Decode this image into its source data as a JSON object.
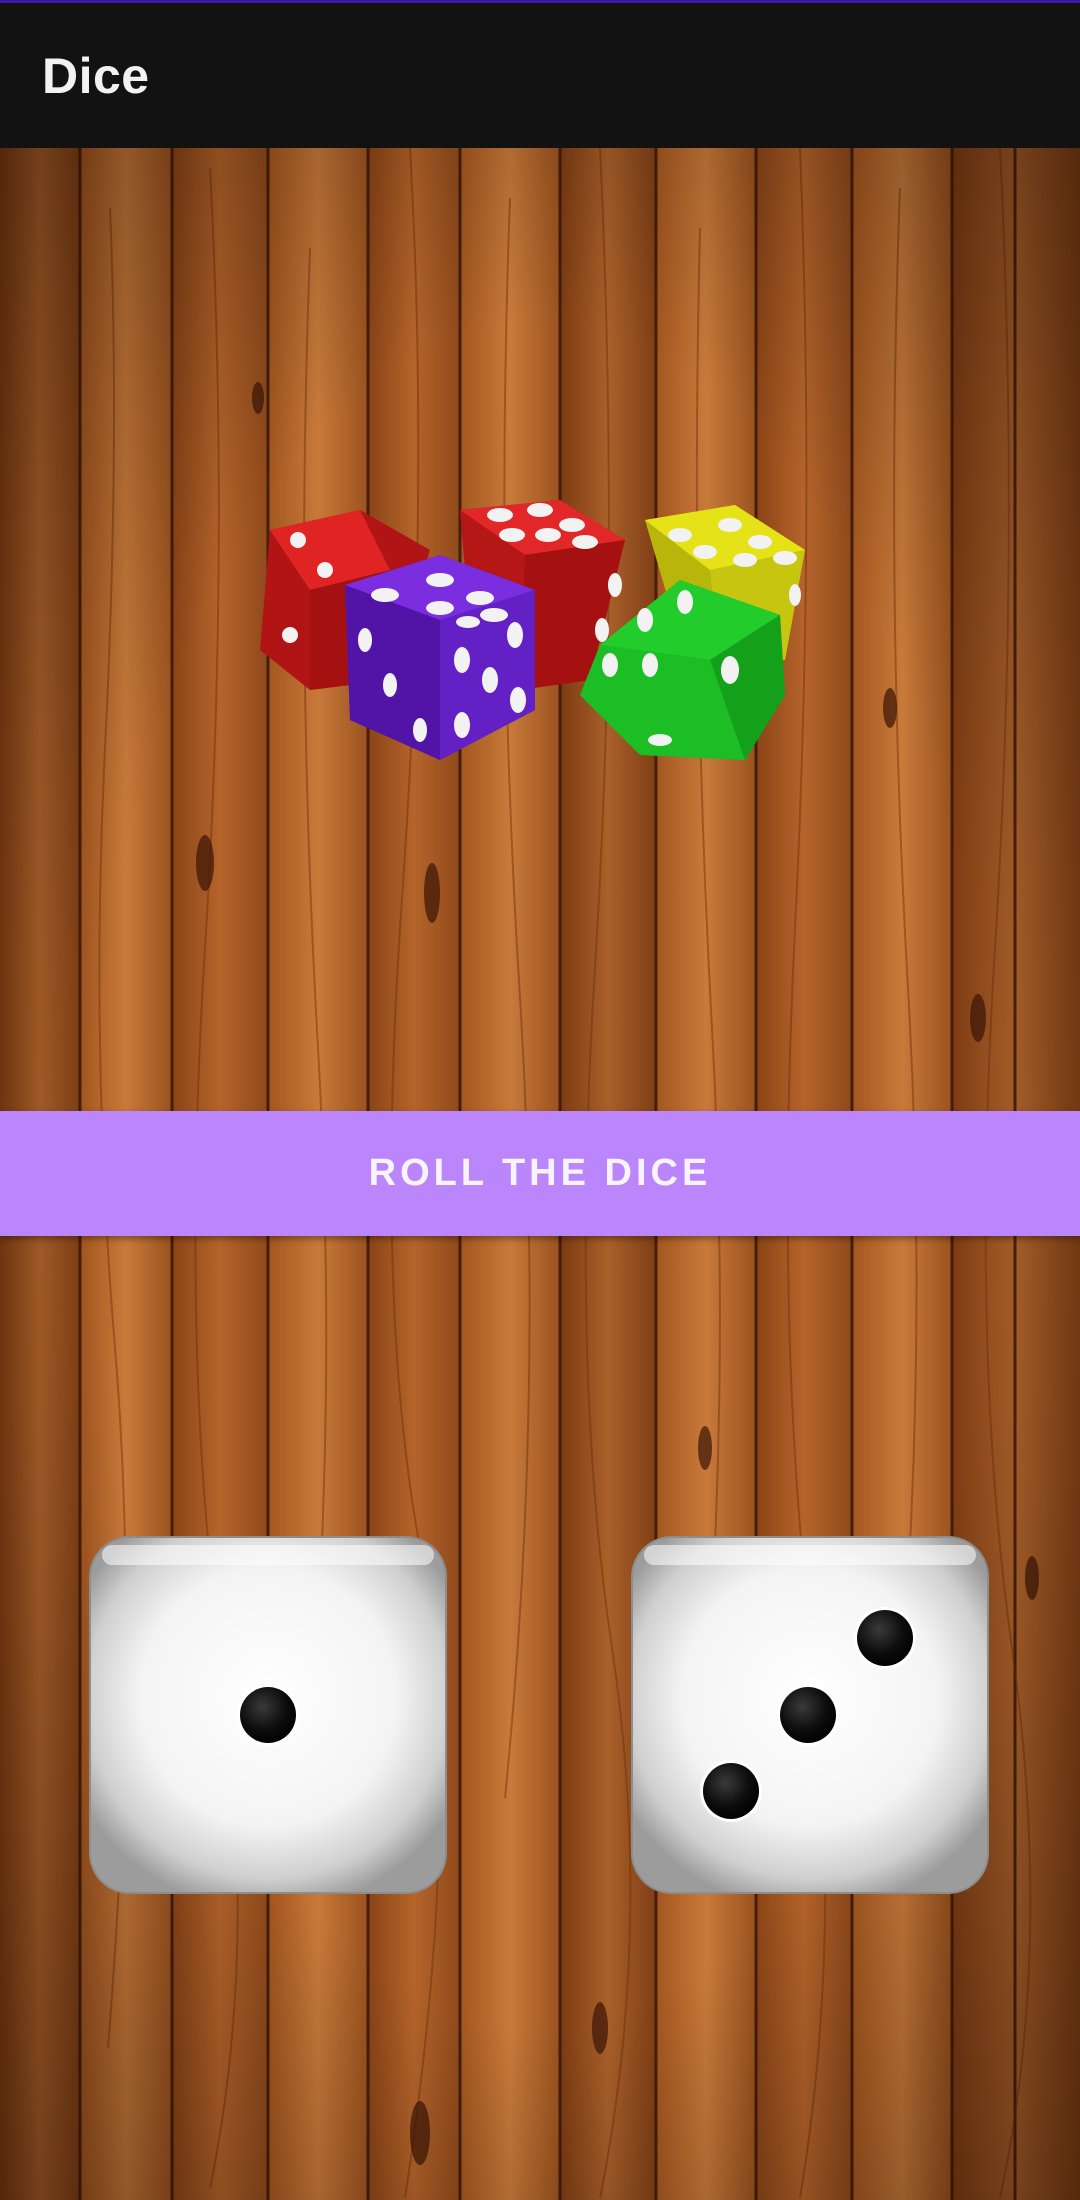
{
  "app": {
    "title": "Dice"
  },
  "hero": {
    "icon": "colored-dice-illustration",
    "dice_colors": [
      "#d31a1a",
      "#6a20c8",
      "#d41f1f",
      "#d4d10f",
      "#1fc42a"
    ]
  },
  "roll_button": {
    "label": "ROLL THE DICE",
    "color": "#bb86fc"
  },
  "results": {
    "left_die": {
      "value": 1,
      "icon": "die-face-1-icon"
    },
    "right_die": {
      "value": 3,
      "icon": "die-face-3-icon"
    }
  },
  "theme": {
    "toolbar_bg": "#121212",
    "background": "wood-planks"
  }
}
